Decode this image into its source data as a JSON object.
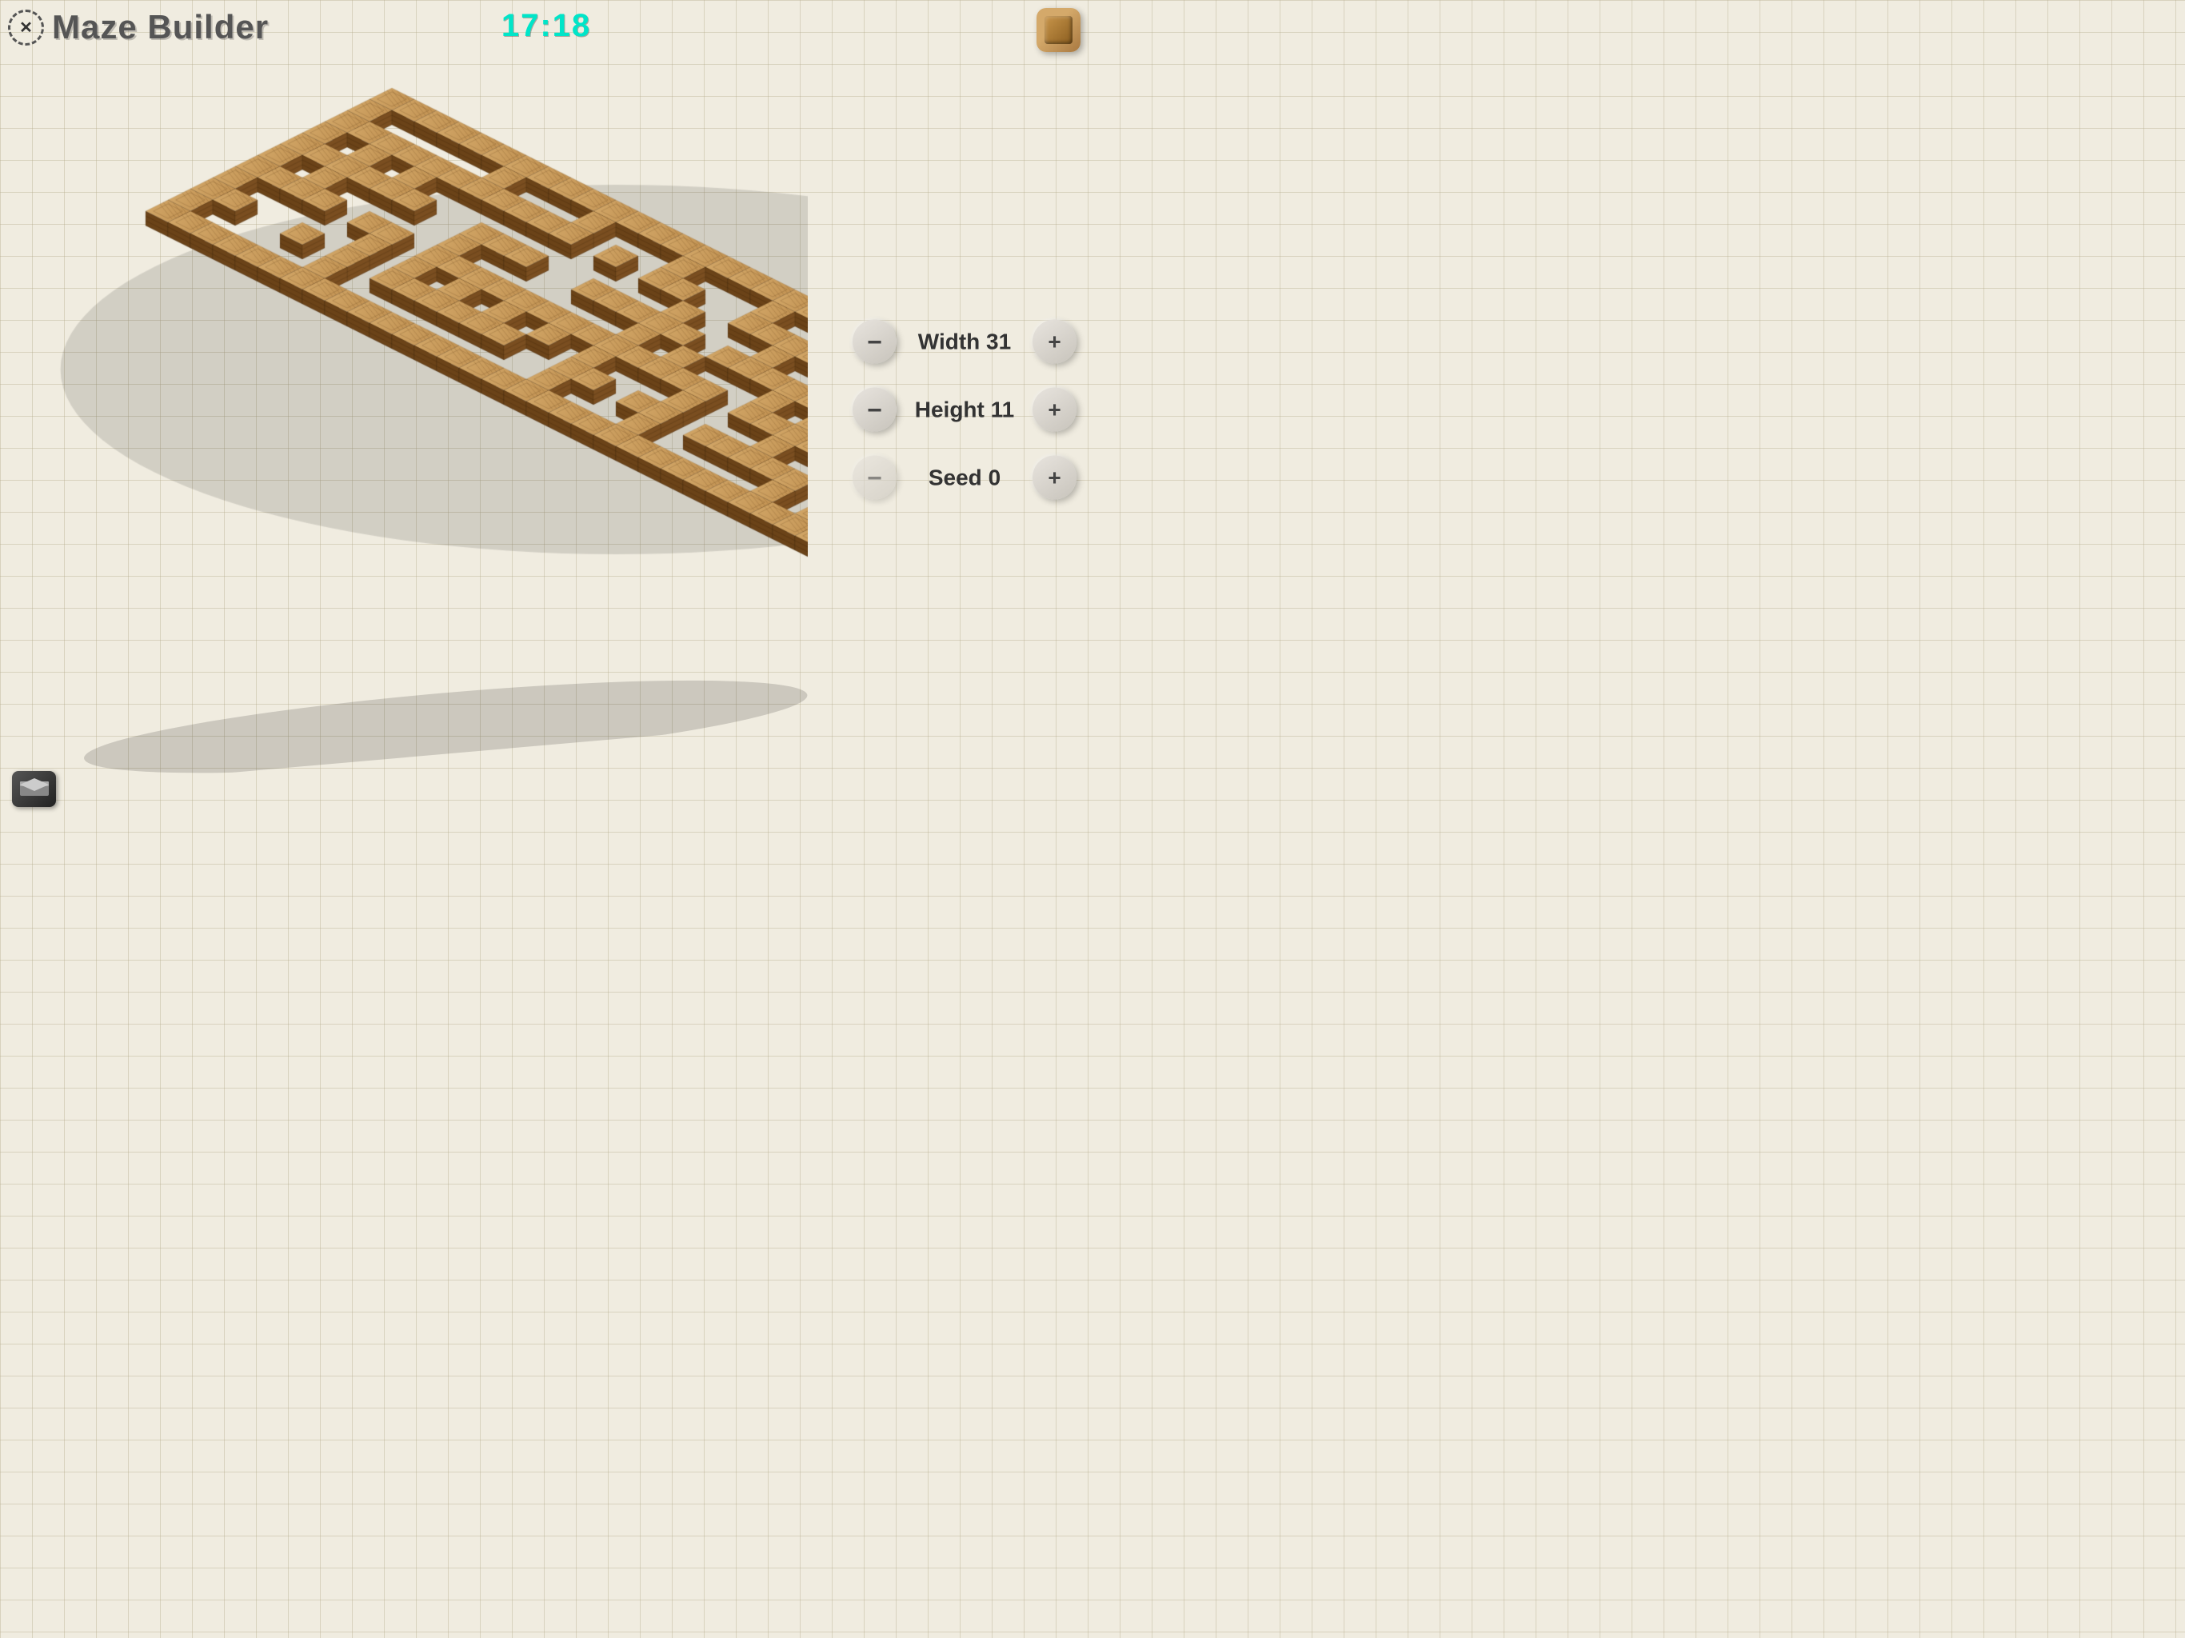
{
  "app": {
    "title": "Maze Builder",
    "timer": "17:18"
  },
  "controls": {
    "width": {
      "label": "Width 31",
      "value": 31,
      "minus": "−",
      "plus": "+"
    },
    "height": {
      "label": "Height 11",
      "value": 11,
      "minus": "−",
      "plus": "+"
    },
    "seed": {
      "label": "Seed 0",
      "value": 0,
      "minus": "−",
      "plus": "+"
    }
  },
  "buttons": {
    "close": "✕",
    "minus": "−",
    "plus": "+"
  }
}
